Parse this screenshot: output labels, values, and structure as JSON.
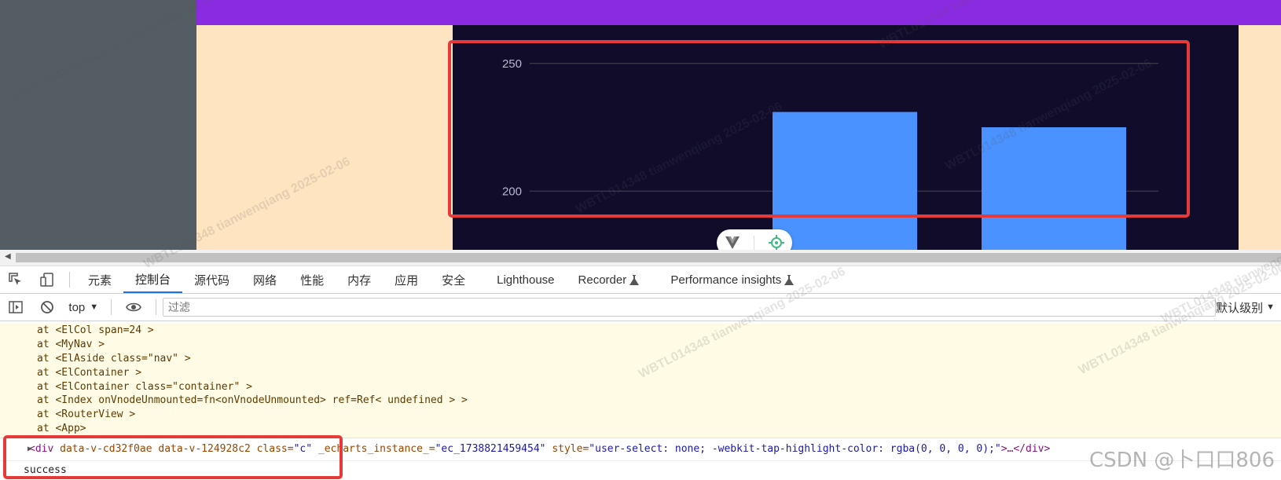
{
  "chart_data": {
    "type": "bar",
    "y_ticks": [
      "250",
      "200"
    ],
    "values": [
      231,
      225
    ],
    "ylim_visible": [
      177,
      265
    ]
  },
  "devtools": {
    "tabs": [
      "元素",
      "控制台",
      "源代码",
      "网络",
      "性能",
      "内存",
      "应用",
      "安全",
      "Lighthouse",
      "Recorder",
      "Performance insights"
    ],
    "active_tab": "控制台",
    "context": "top",
    "filter_placeholder": "过滤",
    "levels": "默认级别",
    "trace": [
      "at <ElCol span=24 >",
      "at <MyNav >",
      "at <ElAside class=\"nav\" >",
      "at <ElContainer >",
      "at <ElContainer class=\"container\" >",
      "at <Index onVnodeUnmounted=fn<onVnodeUnmounted> ref=Ref< undefined > >",
      "at <RouterView >",
      "at <App>"
    ],
    "element_line": {
      "tag_open": "<div",
      "attr1": " data-v-cd32f0ae",
      "attr2": " data-v-124928c2",
      "class_name": " class=",
      "class_value": "\"c\"",
      "instance_name": " _echarts_instance_=",
      "instance_value": "\"ec_1738821459454\"",
      "style_name": " style=",
      "style_value": "\"user-select: none; -webkit-tap-highlight-color: rgba(0, 0, 0, 0);\"",
      "tag_close": ">…</div>"
    },
    "success": "success"
  },
  "watermark": "WBTL014348 tianwenqiang 2025-02-06",
  "csdn": "CSDN @卜口口806",
  "colors": {
    "highlight": "#e63939",
    "bar": "#4992ff",
    "chart_bg": "#100c2a",
    "header": "#8a2be2"
  }
}
